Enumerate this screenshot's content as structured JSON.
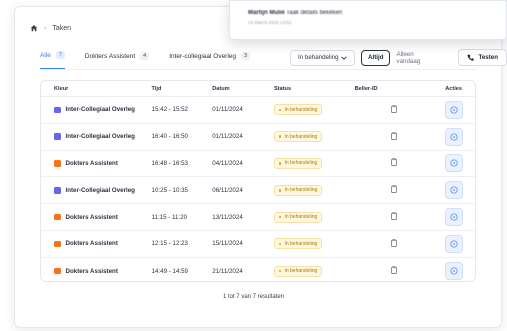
{
  "breadcrumb": {
    "page": "Taken"
  },
  "popup": {
    "name": "Martijn Mulié",
    "action": "Taak details bekeken",
    "date": "14 March 2025 13:52"
  },
  "tabs": [
    {
      "label": "Alle",
      "count": "7",
      "active": true
    },
    {
      "label": "Dokters Assistent",
      "count": "4",
      "active": false
    },
    {
      "label": "Inter-collegiaal Overleg",
      "count": "3",
      "active": false
    }
  ],
  "controls": {
    "status_filter": "In behandeling",
    "toggle_always": "Altijd",
    "toggle_today": "Alleen vandaag",
    "test_button": "Testen"
  },
  "columns": [
    "Kleur",
    "Tijd",
    "Datum",
    "Status",
    "Beller-ID",
    "Acties"
  ],
  "rows": [
    {
      "kleur": "Inter-Collegiaal Overleg",
      "color": "#6366f1",
      "tijd": "15:42 - 15:52",
      "datum": "01/11/2024",
      "status": "In behandeling"
    },
    {
      "kleur": "Inter-Collegiaal Overleg",
      "color": "#6366f1",
      "tijd": "16:40 - 16:50",
      "datum": "01/11/2024",
      "status": "In behandeling"
    },
    {
      "kleur": "Dokters Assistent",
      "color": "#f97316",
      "tijd": "16:48 - 16:53",
      "datum": "04/11/2024",
      "status": "In behandeling"
    },
    {
      "kleur": "Inter-Collegiaal Overleg",
      "color": "#6366f1",
      "tijd": "10:25 - 10:35",
      "datum": "06/11/2024",
      "status": "In behandeling"
    },
    {
      "kleur": "Dokters Assistent",
      "color": "#f97316",
      "tijd": "11:15 - 11:20",
      "datum": "13/11/2024",
      "status": "In behandeling"
    },
    {
      "kleur": "Dokters Assistent",
      "color": "#f97316",
      "tijd": "12:15 - 12:23",
      "datum": "15/11/2024",
      "status": "In behandeling"
    },
    {
      "kleur": "Dokters Assistent",
      "color": "#f97316",
      "tijd": "14:49 - 14:59",
      "datum": "21/11/2024",
      "status": "In behandeling"
    }
  ],
  "pagination": {
    "text": "1 tot 7 van 7 resultaten"
  },
  "icons": {
    "home": "home-icon",
    "chevron": "chevron-down-icon",
    "phone": "phone-icon",
    "clipboard": "clipboard-icon",
    "action": "info-circle-icon"
  }
}
